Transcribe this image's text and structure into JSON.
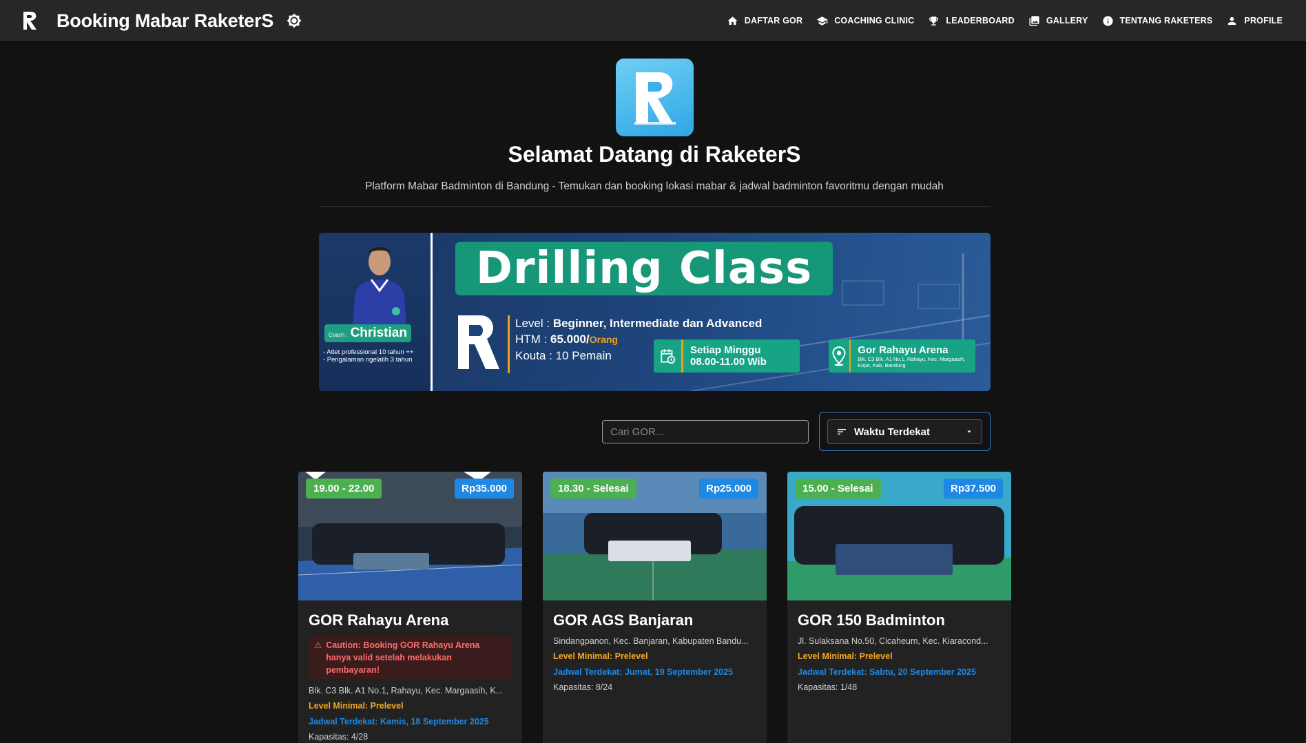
{
  "app": {
    "title": "Booking Mabar RaketerS",
    "logo_icon": "raketers-logo",
    "theme_icon": "brightness-icon"
  },
  "nav": [
    {
      "label": "DAFTAR GOR",
      "icon": "home-icon"
    },
    {
      "label": "COACHING CLINIC",
      "icon": "school-icon"
    },
    {
      "label": "LEADERBOARD",
      "icon": "trophy-icon"
    },
    {
      "label": "GALLERY",
      "icon": "photo-library-icon"
    },
    {
      "label": "TENTANG RAKETERS",
      "icon": "info-icon"
    },
    {
      "label": "PROFILE",
      "icon": "person-icon"
    }
  ],
  "header": {
    "title": "Selamat Datang di RaketerS",
    "subtitle": "Platform Mabar Badminton di Bandung - Temukan dan booking lokasi mabar & jadwal badminton favoritmu dengan mudah"
  },
  "banner": {
    "title": "Drilling Class",
    "coach_prefix": "Coach :",
    "coach_name": "Christian",
    "coach_notes": [
      "- Atlet professional 10 tahun ++",
      "- Pengalaman ngelatih 3 tahun"
    ],
    "level_label": "Level :",
    "level_value": "Beginner, Intermediate dan Advanced",
    "htm_label": "HTM :",
    "htm_value": "65.000/",
    "htm_unit": "Orang",
    "kouta": "Kouta : 10 Pemain",
    "schedule_line1": "Setiap Minggu",
    "schedule_line2": "08.00-11.00 Wib",
    "venue_name": "Gor Rahayu Arena",
    "venue_address": "Blk. C3 Blk. A1 No.1, Rahayu, Kec. Margaasih, Kopo, Kab. Bandung"
  },
  "controls": {
    "search_placeholder": "Cari GOR...",
    "sort_label": "Waktu Terdekat"
  },
  "cards": [
    {
      "time": "19.00 - 22.00",
      "price": "Rp35.000",
      "name": "GOR Rahayu Arena",
      "caution": "Caution: Booking GOR Rahayu Arena hanya valid setelah melakukan pembayaran!",
      "address": "Blk. C3 Blk. A1 No.1, Rahayu, Kec. Margaasih, K...",
      "level": "Level Minimal: Prelevel",
      "schedule": "Jadwal Terdekat: Kamis, 18 September 2025",
      "capacity": "Kapasitas: 4/28"
    },
    {
      "time": "18.30 - Selesai",
      "price": "Rp25.000",
      "name": "GOR AGS Banjaran",
      "address": "Sindangpanon, Kec. Banjaran, Kabupaten Bandu...",
      "level": "Level Minimal: Prelevel",
      "schedule": "Jadwal Terdekat: Jumat, 19 September 2025",
      "capacity": "Kapasitas: 8/24"
    },
    {
      "time": "15.00 - Selesai",
      "price": "Rp37.500",
      "name": "GOR 150 Badminton",
      "address": "Jl. Sulaksana No.50, Cicaheum, Kec. Kiaracond...",
      "level": "Level Minimal: Prelevel",
      "schedule": "Jadwal Terdekat: Sabtu, 20 September 2025",
      "capacity": "Kapasitas: 1/48"
    }
  ],
  "colors": {
    "appbar": "#272727",
    "background": "#121212",
    "accent_green": "#169777",
    "time_badge": "#4caf50",
    "price_badge": "#1e88e5",
    "level_text": "#f5a623",
    "schedule_text": "#1e88e5",
    "caution_text": "#ff6b6b"
  }
}
